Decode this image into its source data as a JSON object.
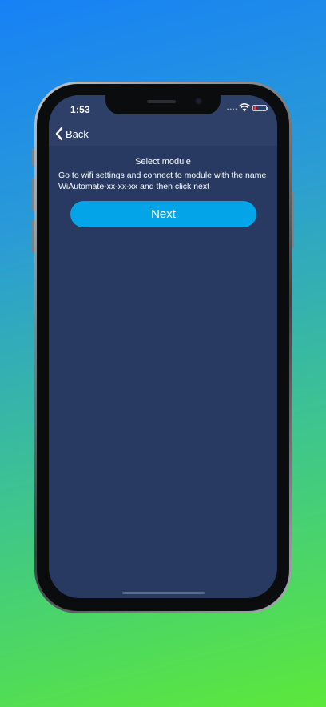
{
  "status_bar": {
    "time": "1:53",
    "signal_icon": "cellular-signal-icon",
    "wifi_icon": "wifi-icon",
    "battery_icon": "battery-low-icon",
    "battery_color": "#ff3b30"
  },
  "nav": {
    "back_label": "Back",
    "back_icon": "chevron-left-icon"
  },
  "main": {
    "title": "Select module",
    "instructions": "Go to wifi settings and connect to module with the name WiAutomate-xx-xx-xx and then click next",
    "next_label": "Next"
  },
  "colors": {
    "screen_background": "#283a61",
    "bar_background": "#2e4068",
    "button_accent": "#04a4e9"
  }
}
